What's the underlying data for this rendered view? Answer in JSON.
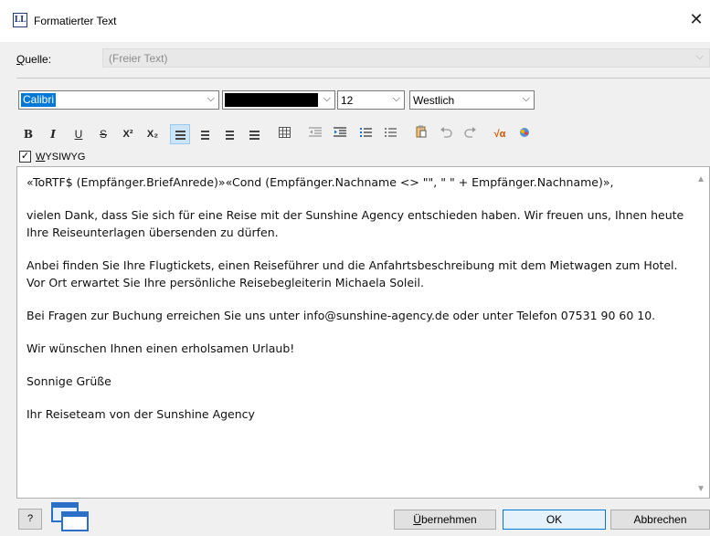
{
  "window": {
    "title": "Formatierter Text",
    "app_icon_text": "LL",
    "close_glyph": "✕"
  },
  "source": {
    "label_accel": "Q",
    "label_rest": "uelle:",
    "value": "(Freier Text)"
  },
  "font": {
    "family": "Calibri",
    "color": "#000000",
    "size": "12",
    "charset": "Westlich"
  },
  "toolbar": {
    "bold": "B",
    "italic": "I",
    "underline": "U",
    "strikethrough": "S",
    "superscript": "X²",
    "subscript": "X₂",
    "formula_label": "√α"
  },
  "wysiwyg": {
    "checked": true,
    "label_accel": "W",
    "label_rest": "YSIWYG"
  },
  "editor": {
    "paragraphs": [
      "«ToRTF$ (Empfänger.BriefAnrede)»«Cond  (Empfänger.Nachname <> \"\", \" \" + Empfänger.Nachname)»,",
      "vielen Dank, dass Sie sich für eine Reise mit der Sunshine Agency entschieden haben. Wir freuen uns, Ihnen heute Ihre Reiseunterlagen übersenden zu dürfen.",
      "Anbei finden Sie Ihre Flugtickets, einen Reiseführer und die Anfahrtsbeschreibung mit dem Mietwagen zum Hotel. Vor Ort erwartet Sie Ihre persönliche Reisebegleiterin Michaela Soleil.",
      "Bei Fragen zur Buchung erreichen Sie uns unter info@sunshine-agency.de oder unter Telefon 07531 90 60 10.",
      "Wir wünschen Ihnen einen erholsamen Urlaub!",
      "Sonnige Grüße",
      "Ihr Reiseteam von der Sunshine Agency"
    ]
  },
  "footer": {
    "help_label": "?",
    "apply_accel": "Ü",
    "apply_rest": "bernehmen",
    "ok": "OK",
    "cancel": "Abbrechen"
  }
}
